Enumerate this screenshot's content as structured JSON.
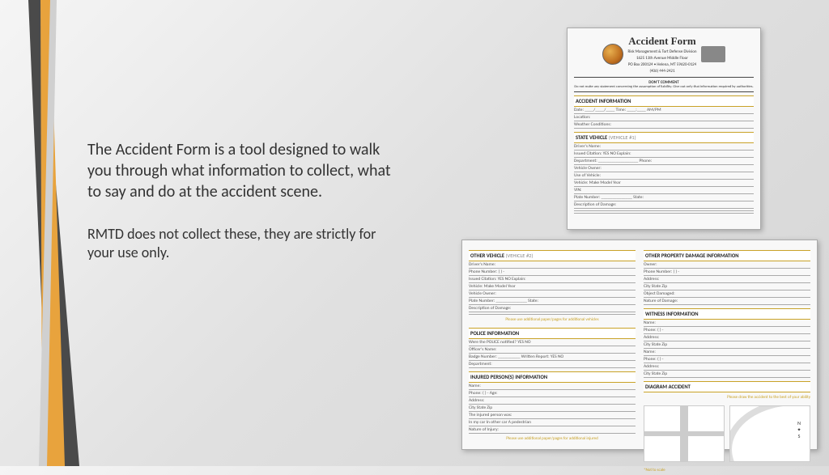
{
  "text": {
    "para1": "The Accident Form is a tool designed to walk you through what information to collect, what to say and do at the accident scene.",
    "para2": "RMTD does not collect these, they are strictly for your use only."
  },
  "form_top": {
    "title": "Accident Form",
    "org": "Risk Management & Tort Defense Division",
    "addr1": "1625 11th Avenue Middle Floor",
    "addr2": "PO Box 200124 • Helena, MT 59620-0124",
    "phone": "(406) 444-2421",
    "warn_title": "DON'T COMMENT",
    "warn_body": "Do not make any statement concerning the assumption of liability. Give out only that information required by authorities.",
    "sec1": "ACCIDENT INFORMATION",
    "sec1_lines": {
      "l1": "Date: ____/____/____    Time: ____:____  AM/PM",
      "l2": "Location:",
      "l3": "Weather Conditions:"
    },
    "sec2_a": "STATE VEHICLE",
    "sec2_b": "(VEHICLE #1)",
    "sec2_lines": {
      "l1": "Driver's Name:",
      "l2": "Issued Citation:  YES  NO  Explain:",
      "l3": "Department: __________________ Phone:",
      "l4": "Vehicle Owner:",
      "l5": "Use of Vehicle:",
      "l6": "Vehicle:        Make            Model            Year",
      "l7": "VIN:",
      "l8": "Plate Number: ______________ State:",
      "l9": "Description of Damage:",
      "l10": " ",
      "l11": " "
    }
  },
  "form_bottom": {
    "left": {
      "sec1_a": "OTHER VEHICLE",
      "sec1_b": "(VEHICLE #2)",
      "sec1_lines": {
        "l1": "Driver's Name:",
        "l2": "Phone Number:  (    )        -",
        "l3": "Issued Citation:  YES  NO  Explain:",
        "l4": "Vehicle:        Make            Model            Year",
        "l5": "Vehicle Owner:",
        "l6": "Plate Number: ______________ State:",
        "l7": "Description of Damage:",
        "l8": " "
      },
      "note1": "Please use additional paper/pages for additional vehicles",
      "sec2": "POLICE INFORMATION",
      "sec2_lines": {
        "l1": "Were the POLICE notified?        YES        NO",
        "l2": "Officer's Name:",
        "l3": "Badge Number: __________  Written Report:  YES  NO",
        "l4": "Department:"
      },
      "sec3": "INJURED PERSON(S) INFORMATION",
      "sec3_lines": {
        "l1": "Name:",
        "l2": "Phone:  (    )    -        Age:",
        "l3": "Address:",
        "l4": "            City                    State            Zip",
        "l5": "The injured person was:",
        "l6": "   In my car        In other car        A pedestrian",
        "l7": "Nature of Injury:"
      },
      "note2": "Please use additional paper/pages for additional injured"
    },
    "right": {
      "sec1": "OTHER PROPERTY DAMAGE INFORMATION",
      "sec1_lines": {
        "l1": "Owner:",
        "l2": "Phone Number:  (    )        -",
        "l3": "Address:",
        "l4": "            City                    State            Zip",
        "l5": "Object Damaged:",
        "l6": "Nature of Damage:"
      },
      "sec2": "WITNESS INFORMATION",
      "sec2_lines": {
        "l1": "Name:",
        "l2": "Phone:  (    )        -",
        "l3": "Address:",
        "l4": "            City                    State            Zip",
        "l5": "Name:",
        "l6": "Phone:  (    )        -",
        "l7": "Address:",
        "l8": "            City                    State            Zip"
      },
      "sec3": "DIAGRAM ACCIDENT",
      "diag_note": "Please draw the accident to the best of your ability",
      "compass": "N\n✦\nS",
      "note": "*Not to scale"
    }
  }
}
